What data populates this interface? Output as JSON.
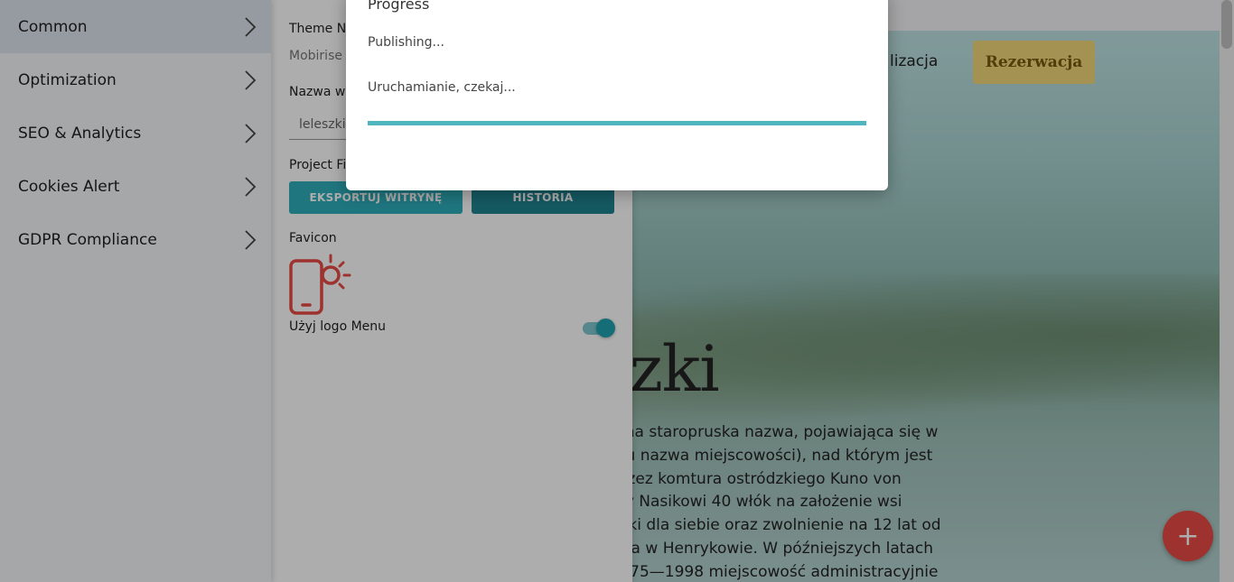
{
  "menu": {
    "items": [
      {
        "label": "Common",
        "active": true
      },
      {
        "label": "Optimization"
      },
      {
        "label": "SEO & Analytics"
      },
      {
        "label": "Cookies Alert"
      },
      {
        "label": "GDPR Compliance"
      }
    ]
  },
  "settings": {
    "theme_label": "Theme N",
    "theme_value": "Mobirise",
    "site_name_label": "Nazwa w",
    "site_name_value": "leleszki",
    "project_files_label": "Project Fi",
    "export_button": "EKSPORTUJ WITRYNĘ",
    "history_button": "HISTORIA",
    "favicon_label": "Favicon",
    "use_logo_label": "Użyj logo Menu",
    "use_logo_enabled": true
  },
  "preview": {
    "nav_link": "lizacja",
    "nav_button": "Rezerwacja",
    "hero_title": "szki",
    "hero_lines": [
      "(dawna staropruska nazwa, pojawiająca się w",
      "0 roku nazwa miejscowości), nad którym jest",
      "im przez komtura ostródzkiego Kuno von",
      "wtedy Nasikowi 40 włók na założenie wsi",
      "4 włóki dla siebie oraz zwolnienie na 12 lat od",
      "ościoła w Henrykowie. W późniejszych latach",
      "ch 1975—1998 miejscowość administracyjnie"
    ],
    "fab_label": "+"
  },
  "dialog": {
    "title": "Progress",
    "status": "Publishing...",
    "message": "Uruchamianie, czekaj...",
    "progress_percent": 100
  },
  "colors": {
    "accent": "#2eaebb",
    "accent_dark": "#1f8591",
    "fab": "#e84b44",
    "button_yellow": "#f2d77a"
  }
}
